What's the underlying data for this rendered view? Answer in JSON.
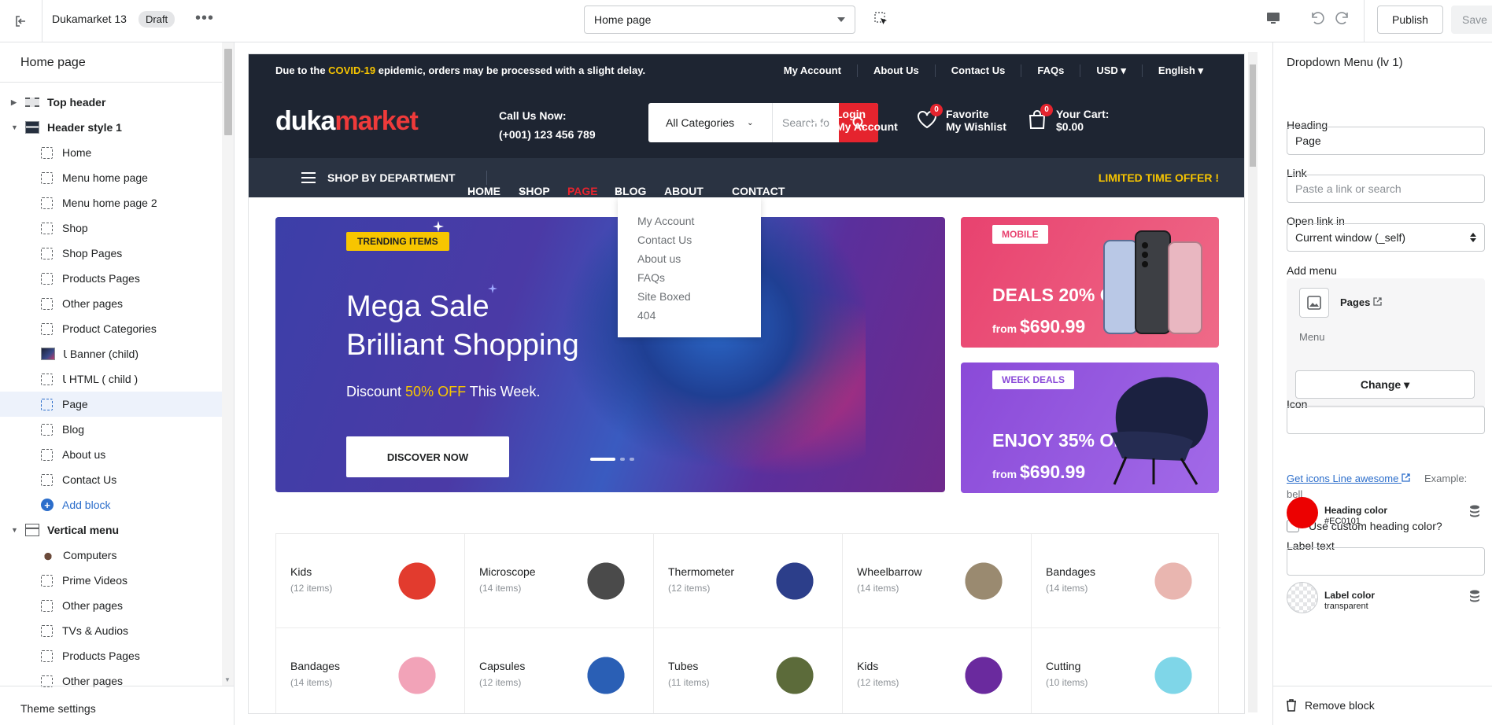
{
  "topbar": {
    "store_name": "Dukamarket 13",
    "status_badge": "Draft",
    "more": "•••",
    "page_select": "Home page",
    "publish": "Publish",
    "save": "Save"
  },
  "sidebar": {
    "title": "Home page",
    "items": [
      {
        "label": "Top header",
        "level": 0,
        "expanded": false,
        "icon": "header-icon"
      },
      {
        "label": "Header style 1",
        "level": 0,
        "expanded": true,
        "icon": "section-thumbnail-icon"
      },
      {
        "label": "Home",
        "level": 1,
        "icon": "block-icon"
      },
      {
        "label": "Menu home page",
        "level": 1,
        "icon": "block-icon"
      },
      {
        "label": "Menu home page 2",
        "level": 1,
        "icon": "block-icon"
      },
      {
        "label": "Shop",
        "level": 1,
        "icon": "block-icon"
      },
      {
        "label": "Shop Pages",
        "level": 1,
        "icon": "block-icon"
      },
      {
        "label": "Products Pages",
        "level": 1,
        "icon": "block-icon"
      },
      {
        "label": "Other pages",
        "level": 1,
        "icon": "block-icon"
      },
      {
        "label": "Product Categories",
        "level": 1,
        "icon": "block-icon"
      },
      {
        "label": "Ꙇ Banner (child)",
        "level": 1,
        "icon": "banner-thumbnail-icon"
      },
      {
        "label": "Ꙇ HTML ( child )",
        "level": 1,
        "icon": "block-icon"
      },
      {
        "label": "Page",
        "level": 1,
        "icon": "block-icon",
        "selected": true
      },
      {
        "label": "Blog",
        "level": 1,
        "icon": "block-icon"
      },
      {
        "label": "About us",
        "level": 1,
        "icon": "block-icon"
      },
      {
        "label": "Contact Us",
        "level": 1,
        "icon": "block-icon"
      },
      {
        "label": "Add block",
        "level": 1,
        "icon": "add-icon",
        "action": true
      },
      {
        "label": "Vertical menu",
        "level": 0,
        "expanded": true,
        "icon": "menu-thumbnail-icon"
      },
      {
        "label": "Computers",
        "level": 1,
        "icon": "computer-thumbnail-icon"
      },
      {
        "label": "Prime Videos",
        "level": 1,
        "icon": "block-icon"
      },
      {
        "label": "Other pages",
        "level": 1,
        "icon": "block-icon"
      },
      {
        "label": "TVs & Audios",
        "level": 1,
        "icon": "block-icon"
      },
      {
        "label": "Products Pages",
        "level": 1,
        "icon": "block-icon"
      },
      {
        "label": "Other pages",
        "level": 1,
        "icon": "block-icon"
      }
    ],
    "footer": "Theme settings"
  },
  "site": {
    "notice_pre": "Due to the ",
    "notice_hl": "COVID-19",
    "notice_post": " epidemic, orders may be processed with a slight delay.",
    "top_links": [
      "My Account",
      "About Us",
      "Contact Us",
      "FAQs",
      "USD ▾",
      "English ▾"
    ],
    "logo_a": "duka",
    "logo_b": "market",
    "call_label": "Call Us Now:",
    "call_number": "(+001) 123 456 789",
    "search_category": "All Categories",
    "search_placeholder": "Search fo",
    "login_line1": "Login",
    "login_line2": "My Account",
    "fav_count": "0",
    "fav_line1": "Favorite",
    "fav_line2": "My Wishlist",
    "cart_count": "0",
    "cart_line1": "Your Cart:",
    "cart_line2": "$0.00",
    "dept": "SHOP BY DEPARTMENT",
    "nav": [
      "HOME",
      "SHOP",
      "PAGE",
      "BLOG",
      "ABOUT US",
      "CONTACT US"
    ],
    "nav_active": "PAGE",
    "offer": "LIMITED TIME OFFER !",
    "dropdown": [
      "My Account",
      "Contact Us",
      "About us",
      "FAQs",
      "Site Boxed",
      "404"
    ],
    "hero": {
      "tag": "TRENDING ITEMS",
      "line1": "Mega Sale",
      "line2": "Brilliant Shopping",
      "sub_pre": "Discount ",
      "sub_hl": "50% OFF",
      "sub_post": " This Week.",
      "button": "DISCOVER NOW"
    },
    "promo1": {
      "tag": "MOBILE",
      "title": "DEALS 20% OFF",
      "from": "from",
      "price": "$690.99"
    },
    "promo2": {
      "tag": "WEEK DEALS",
      "title": "ENJOY 35% OFF",
      "from": "from",
      "price": "$690.99"
    },
    "categories": [
      {
        "name": "Kids",
        "count": "(12 items)",
        "color": "#e23b2e"
      },
      {
        "name": "Microscope",
        "count": "(14 items)",
        "color": "#4a4a4a"
      },
      {
        "name": "Thermometer",
        "count": "(12 items)",
        "color": "#2c3e8a"
      },
      {
        "name": "Wheelbarrow",
        "count": "(14 items)",
        "color": "#9a8a70"
      },
      {
        "name": "Bandages",
        "count": "(14 items)",
        "color": "#e9b6b0"
      },
      {
        "name": "Bandages",
        "count": "(14 items)",
        "color": "#f2a3b8"
      },
      {
        "name": "Capsules",
        "count": "(12 items)",
        "color": "#2a5fb5"
      },
      {
        "name": "Tubes",
        "count": "(11 items)",
        "color": "#5c6b3a"
      },
      {
        "name": "Kids",
        "count": "(12 items)",
        "color": "#6a2a9e"
      },
      {
        "name": "Cutting",
        "count": "(10 items)",
        "color": "#7fd6e8"
      }
    ]
  },
  "panel": {
    "title": "Dropdown Menu (lv 1)",
    "heading_label": "Heading",
    "heading_value": "Page",
    "link_label": "Link",
    "link_placeholder": "Paste a link or search",
    "open_label": "Open link in",
    "open_value": "Current window (_self)",
    "add_menu_label": "Add menu",
    "menu_name": "Pages",
    "menu_type": "Menu",
    "change_button": "Change ▾",
    "icon_label": "Icon",
    "icons_link": "Get icons Line awesome",
    "example": "Example:",
    "example_value": "bell",
    "custom_heading": "Use custom heading color?",
    "heading_color_label": "Heading color",
    "heading_color_value": "#EC0101",
    "label_text_label": "Label text",
    "label_color_label": "Label color",
    "label_color_value": "transparent",
    "remove": "Remove block"
  },
  "colors": {
    "heading_color": "#EC0101",
    "accent": "#2c6ecb",
    "site_dark": "#1e2532",
    "site_red": "#e5242e",
    "site_yellow": "#f7c500"
  }
}
